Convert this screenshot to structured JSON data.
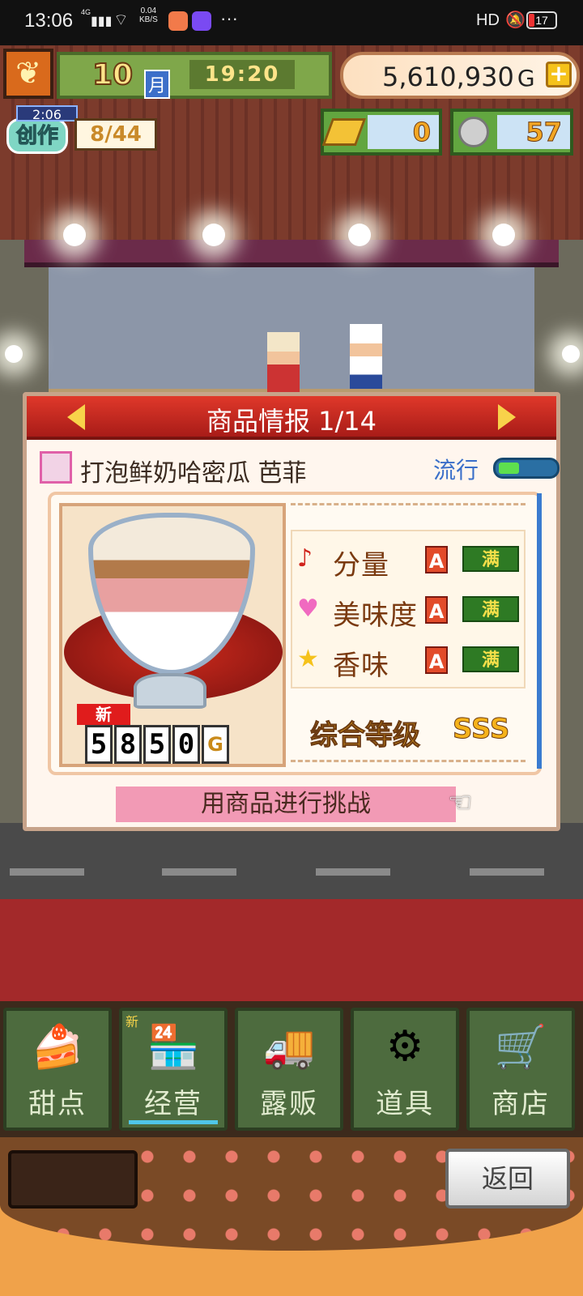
{
  "status_bar": {
    "time": "13:06",
    "network": "4G",
    "speed_top": "0.04",
    "speed_bottom": "KB/S",
    "more": "···",
    "hd": "HD",
    "battery": "17"
  },
  "topbar": {
    "month_number": "10",
    "month_label": "月",
    "clock": "19:20",
    "money": "5,610,930",
    "currency": "G",
    "plus": "+"
  },
  "create": {
    "timer": "2:06",
    "label": "创作",
    "count": "8/44"
  },
  "resources": {
    "gold_bars": "0",
    "medals": "57"
  },
  "panel": {
    "title": "商品情报 1/14",
    "product_name": "打泡鲜奶哈密瓜 芭菲",
    "trend_label": "流行",
    "trend_level": 0.35,
    "new_badge": "新",
    "price_digits": [
      "5",
      "8",
      "5",
      "0"
    ],
    "price_symbol": "G",
    "stats": [
      {
        "icon": "music-note-icon",
        "glyph": "♪",
        "color": "#d0241c",
        "label": "分量",
        "grade": "A",
        "level": "满"
      },
      {
        "icon": "heart-icon",
        "glyph": "♥",
        "color": "#f06ac0",
        "label": "美味度",
        "grade": "A",
        "level": "满"
      },
      {
        "icon": "star-icon",
        "glyph": "★",
        "color": "#f5c21b",
        "label": "香味",
        "grade": "A",
        "level": "满"
      }
    ],
    "overall_label": "综合等级",
    "overall_value": "SSS",
    "challenge_button": "用商品进行挑战"
  },
  "nav": [
    {
      "key": "dessert",
      "label": "甜点",
      "icon": "cake-icon",
      "glyph": "🍰",
      "new": ""
    },
    {
      "key": "manage",
      "label": "经营",
      "icon": "shop-icon",
      "glyph": "🏪",
      "new": "新"
    },
    {
      "key": "stall",
      "label": "露贩",
      "icon": "food-truck-icon",
      "glyph": "🚚",
      "new": ""
    },
    {
      "key": "items",
      "label": "道具",
      "icon": "gear-bag-icon",
      "glyph": "⚙",
      "new": ""
    },
    {
      "key": "store",
      "label": "商店",
      "icon": "cart-icon",
      "glyph": "🛒",
      "new": ""
    }
  ],
  "back_button": "返回"
}
